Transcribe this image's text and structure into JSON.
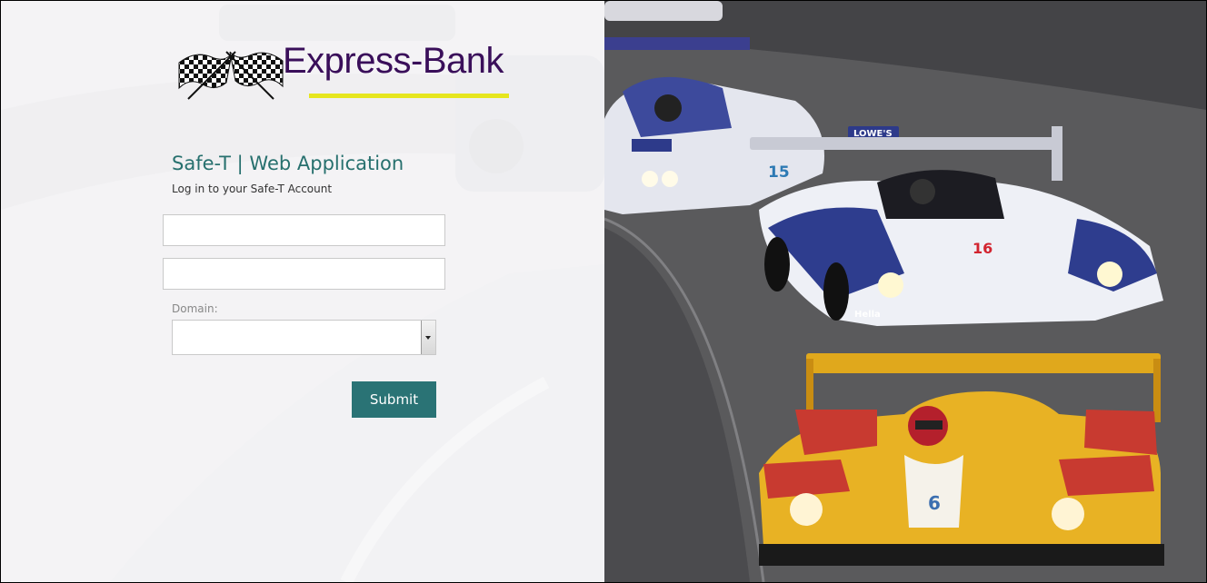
{
  "brand": {
    "name": "Express-Bank",
    "text_color": "#3a0f5a",
    "underline_color": "#e6e61e",
    "icon": "checkered-flags-icon"
  },
  "login": {
    "title": "Safe-T | Web Application",
    "subtitle": "Log in to your Safe-T Account",
    "username_value": "",
    "password_value": "",
    "domain_label": "Domain:",
    "domain_value": "",
    "submit_label": "Submit"
  },
  "colors": {
    "accent": "#2a7375",
    "title": "#27706e"
  },
  "photo": {
    "cars": [
      {
        "number": "15",
        "sponsor": "LOWE'S"
      },
      {
        "number": "16",
        "sponsor": "Hella"
      },
      {
        "number": "6",
        "sponsor": ""
      }
    ]
  }
}
